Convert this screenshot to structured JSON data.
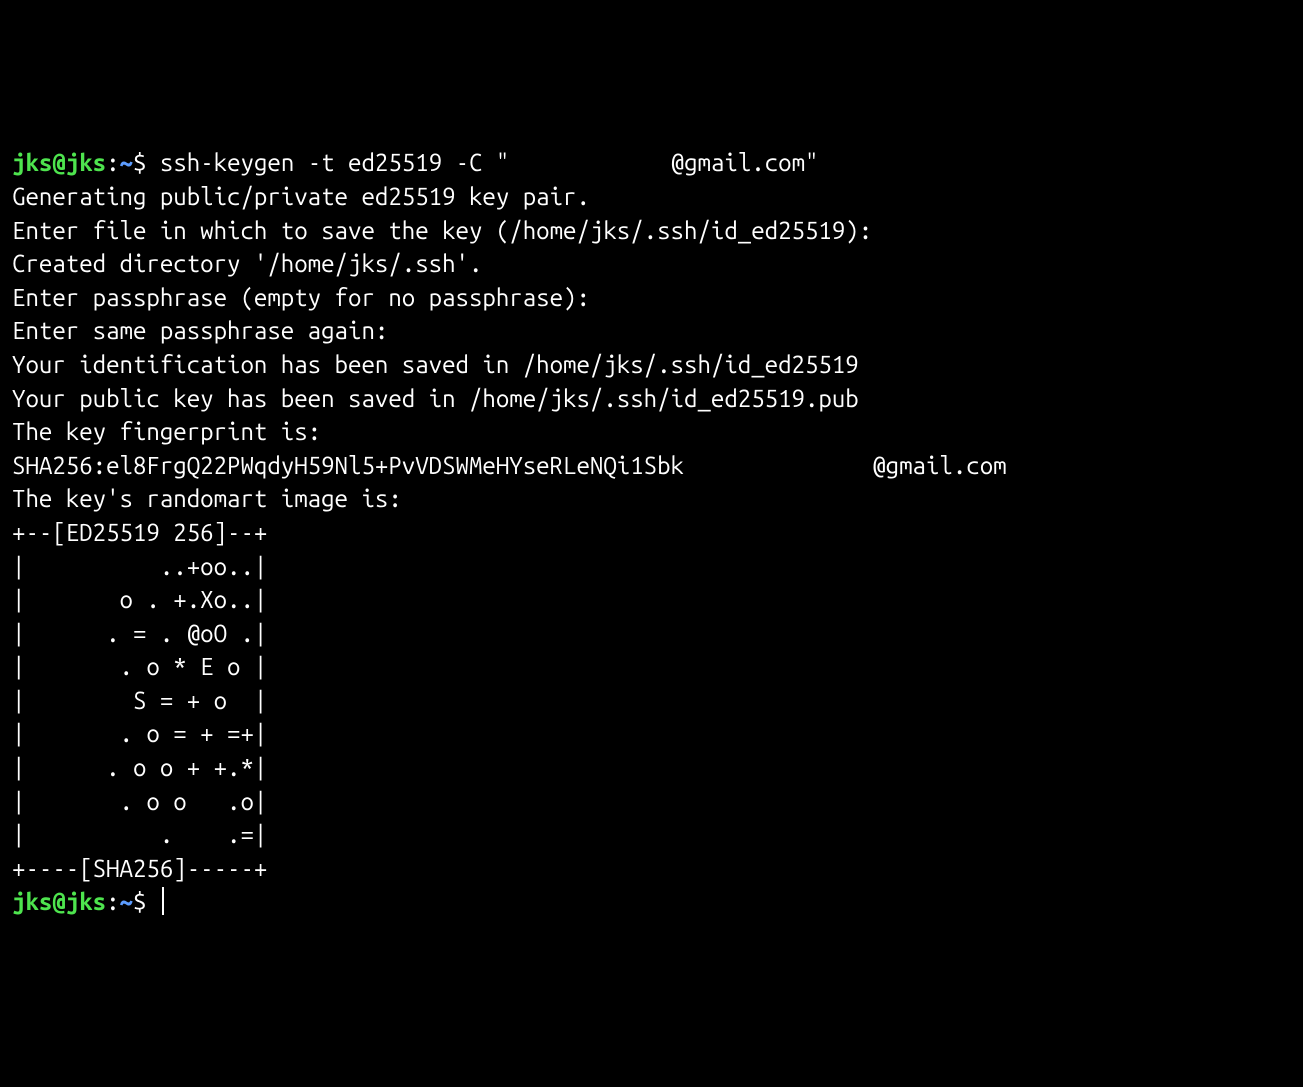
{
  "prompt1": {
    "user": "jks@jks",
    "colon": ":",
    "path": "~",
    "dollar": "$ ",
    "command_pre": "ssh-keygen -t ed25519 -C \"",
    "redacted": "            ",
    "command_post": "@gmail.com\""
  },
  "output": {
    "line1": "Generating public/private ed25519 key pair.",
    "line2": "Enter file in which to save the key (/home/jks/.ssh/id_ed25519):",
    "line3": "Created directory '/home/jks/.ssh'.",
    "line4": "Enter passphrase (empty for no passphrase):",
    "line5": "Enter same passphrase again:",
    "line6": "Your identification has been saved in /home/jks/.ssh/id_ed25519",
    "line7": "Your public key has been saved in /home/jks/.ssh/id_ed25519.pub",
    "line8": "The key fingerprint is:",
    "fingerprint_pre": "SHA256:el8FrgQ22PWqdyH59Nl5+PvVDSWMeHYseRLeNQi1Sbk ",
    "fingerprint_redacted": "             ",
    "fingerprint_post": "@gmail.com",
    "line10": "The key's randomart image is:",
    "art1": "+--[ED25519 256]--+",
    "art2": "|          ..+oo..|",
    "art3": "|       o . +.Xo..|",
    "art4": "|      . = . @oO .|",
    "art5": "|       . o * E o |",
    "art6": "|        S = + o  |",
    "art7": "|       . o = + =+|",
    "art8": "|      . o o + +.*|",
    "art9": "|       . o o   .o|",
    "art10": "|          .    .=|",
    "art11": "+----[SHA256]-----+"
  },
  "prompt2": {
    "user": "jks@jks",
    "colon": ":",
    "path": "~",
    "dollar": "$ "
  }
}
